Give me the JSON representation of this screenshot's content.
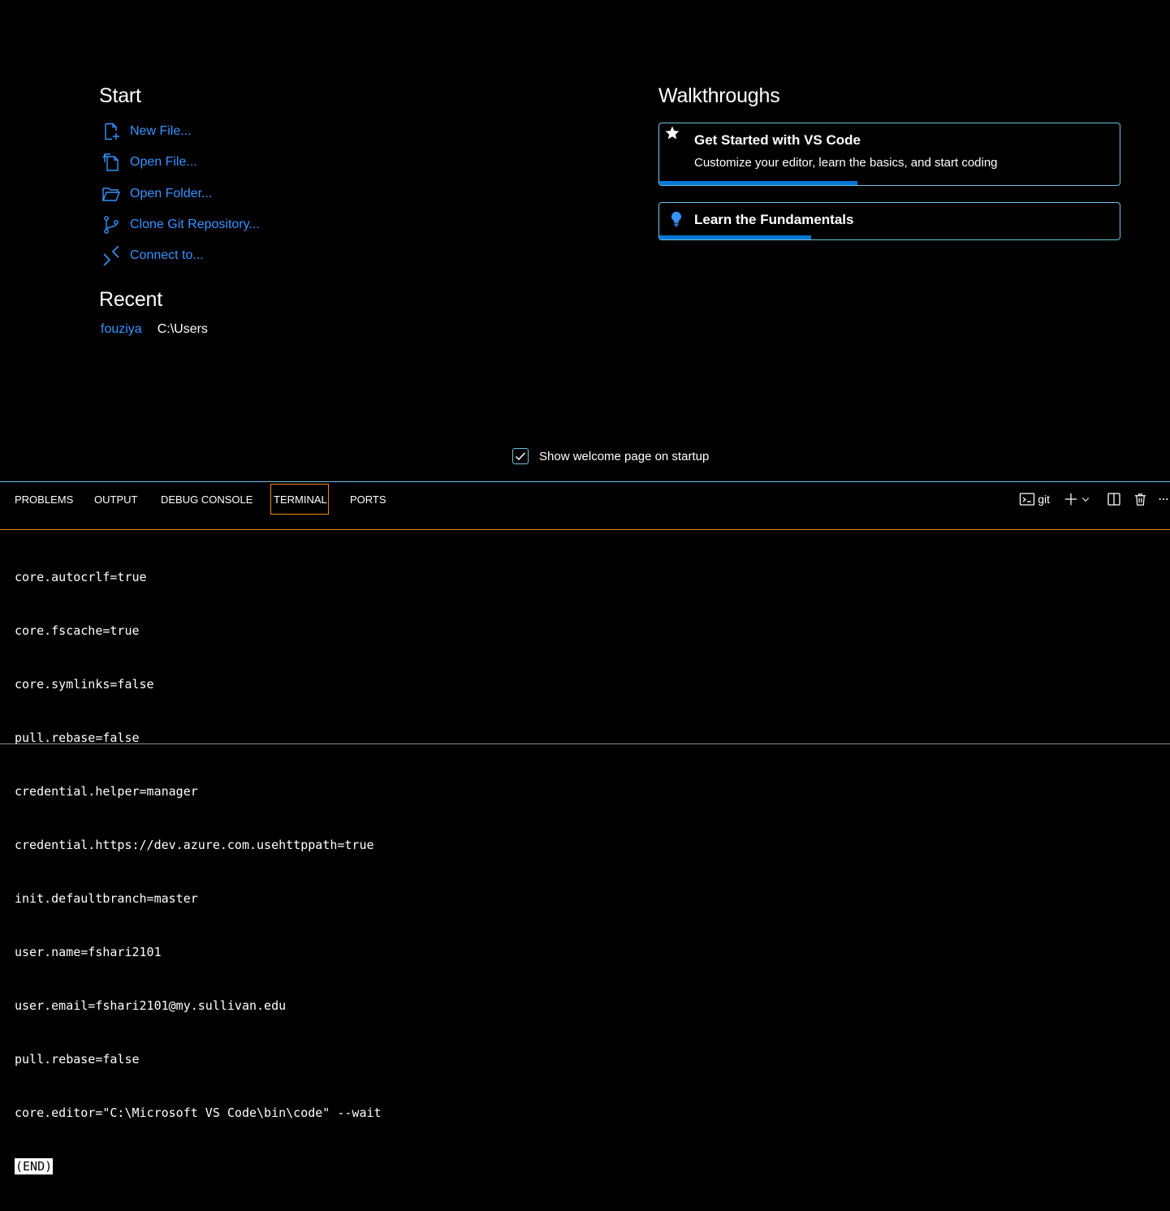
{
  "start": {
    "title": "Start",
    "items": [
      {
        "label": "New File...",
        "icon": "new-file-icon"
      },
      {
        "label": "Open File...",
        "icon": "open-file-icon"
      },
      {
        "label": "Open Folder...",
        "icon": "open-folder-icon"
      },
      {
        "label": "Clone Git Repository...",
        "icon": "git-branch-icon"
      },
      {
        "label": "Connect to...",
        "icon": "remote-connect-icon"
      }
    ]
  },
  "recent": {
    "title": "Recent",
    "items": [
      {
        "name": "fouziya",
        "path": "C:\\Users"
      }
    ]
  },
  "walkthroughs": {
    "title": "Walkthroughs",
    "cards": [
      {
        "title": "Get Started with VS Code",
        "description": "Customize your editor, learn the basics, and start coding",
        "icon": "star-icon",
        "progress": 0.43
      },
      {
        "title": "Learn the Fundamentals",
        "icon": "lightbulb-icon",
        "progress": 0.33
      }
    ]
  },
  "welcome_checkbox": {
    "label": "Show welcome page on startup",
    "checked": true
  },
  "panel": {
    "tabs": [
      "PROBLEMS",
      "OUTPUT",
      "DEBUG CONSOLE",
      "TERMINAL",
      "PORTS"
    ],
    "active_tab": "TERMINAL",
    "terminal_name": "git",
    "actions": [
      "terminal-icon",
      "add-icon",
      "chevron-down-icon",
      "split-icon",
      "trash-icon",
      "more-icon"
    ]
  },
  "terminal": {
    "lines": [
      "core.autocrlf=true",
      "core.fscache=true",
      "core.symlinks=false",
      "pull.rebase=false",
      "credential.helper=manager",
      "credential.https://dev.azure.com.usehttppath=true",
      "init.defaultbranch=master",
      "user.name=fshari2101",
      "user.email=fshari2101@my.sullivan.edu",
      "pull.rebase=false",
      "core.editor=\"C:\\Microsoft VS Code\\bin\\code\" --wait"
    ],
    "end_marker": "(END)"
  },
  "colors": {
    "link": "#3794ff",
    "border": "#6fc3df",
    "active_tab_border": "#f38518",
    "progress": "#0078d4"
  }
}
